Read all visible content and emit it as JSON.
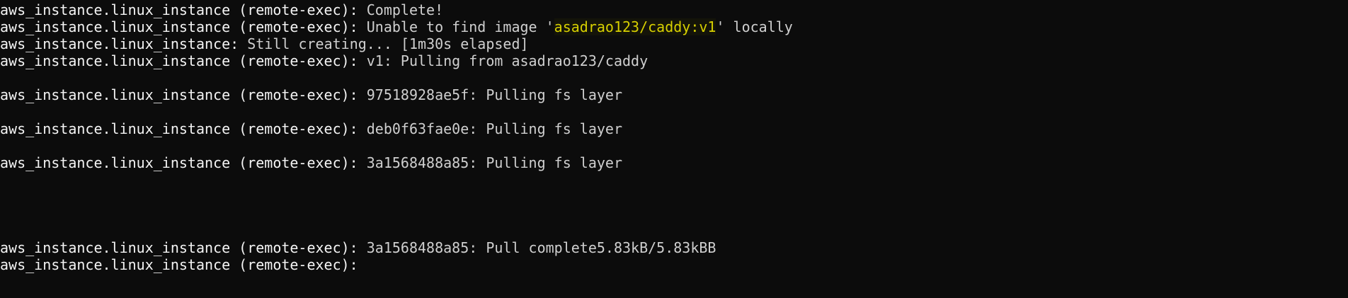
{
  "terminal": {
    "colors": {
      "background": "#0c0c0c",
      "text": "#f0f0f0",
      "highlight_text": "#d7d000"
    },
    "lines": [
      {
        "prefix": "aws_instance.linux_instance (remote-exec): ",
        "text": "Complete!"
      },
      {
        "prefix": "aws_instance.linux_instance (remote-exec): ",
        "before": "Unable to find image '",
        "highlight": "asadrao123/caddy:v1",
        "after": "' locally"
      },
      {
        "prefix": "aws_instance.linux_instance: ",
        "text": "Still creating... [1m30s elapsed]"
      },
      {
        "prefix": "aws_instance.linux_instance (remote-exec): ",
        "text": "v1: Pulling from asadrao123/caddy"
      },
      {
        "prefix": "aws_instance.linux_instance (remote-exec): ",
        "text": "97518928ae5f: Pulling fs layer"
      },
      {
        "prefix": "aws_instance.linux_instance (remote-exec): ",
        "text": "deb0f63fae0e: Pulling fs layer"
      },
      {
        "prefix": "aws_instance.linux_instance (remote-exec): ",
        "text": "3a1568488a85: Pulling fs layer"
      },
      {
        "prefix": "aws_instance.linux_instance (remote-exec): ",
        "text": "3a1568488a85: Pull complete5.83kB/5.83kBB"
      },
      {
        "prefix": "aws_instance.linux_instance (remote-exec): ",
        "text": ""
      }
    ]
  }
}
